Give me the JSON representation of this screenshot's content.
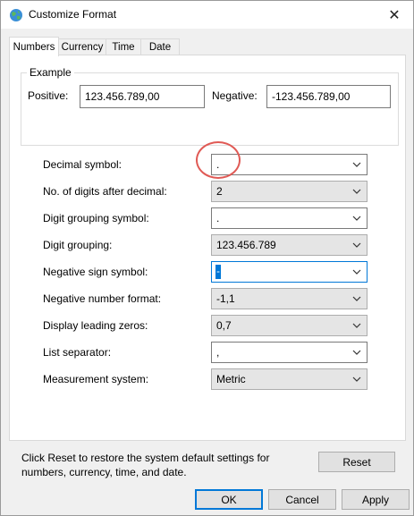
{
  "window": {
    "title": "Customize Format",
    "close_glyph": "✕"
  },
  "tabs": [
    {
      "label": "Numbers"
    },
    {
      "label": "Currency"
    },
    {
      "label": "Time"
    },
    {
      "label": "Date"
    }
  ],
  "example": {
    "legend": "Example",
    "positive_label": "Positive:",
    "positive_value": "123.456.789,00",
    "negative_label": "Negative:",
    "negative_value": "-123.456.789,00"
  },
  "settings": [
    {
      "label": "Decimal symbol:",
      "value": "."
    },
    {
      "label": "No. of digits after decimal:",
      "value": "2"
    },
    {
      "label": "Digit grouping symbol:",
      "value": "."
    },
    {
      "label": "Digit grouping:",
      "value": "123.456.789"
    },
    {
      "label": "Negative sign symbol:",
      "value": "-"
    },
    {
      "label": "Negative number format:",
      "value": "-1,1"
    },
    {
      "label": "Display leading zeros:",
      "value": "0,7"
    },
    {
      "label": "List separator:",
      "value": ","
    },
    {
      "label": "Measurement system:",
      "value": "Metric"
    }
  ],
  "footer": {
    "reset_text": "Click Reset to restore the system default settings for numbers, currency, time, and date.",
    "reset_label": "Reset",
    "ok_label": "OK",
    "cancel_label": "Cancel",
    "apply_label": "Apply"
  },
  "colors": {
    "accent": "#0078d7",
    "annotation_circle": "#e05a55"
  },
  "icons": [
    "globe-icon",
    "close-icon",
    "chevron-down-icon"
  ]
}
